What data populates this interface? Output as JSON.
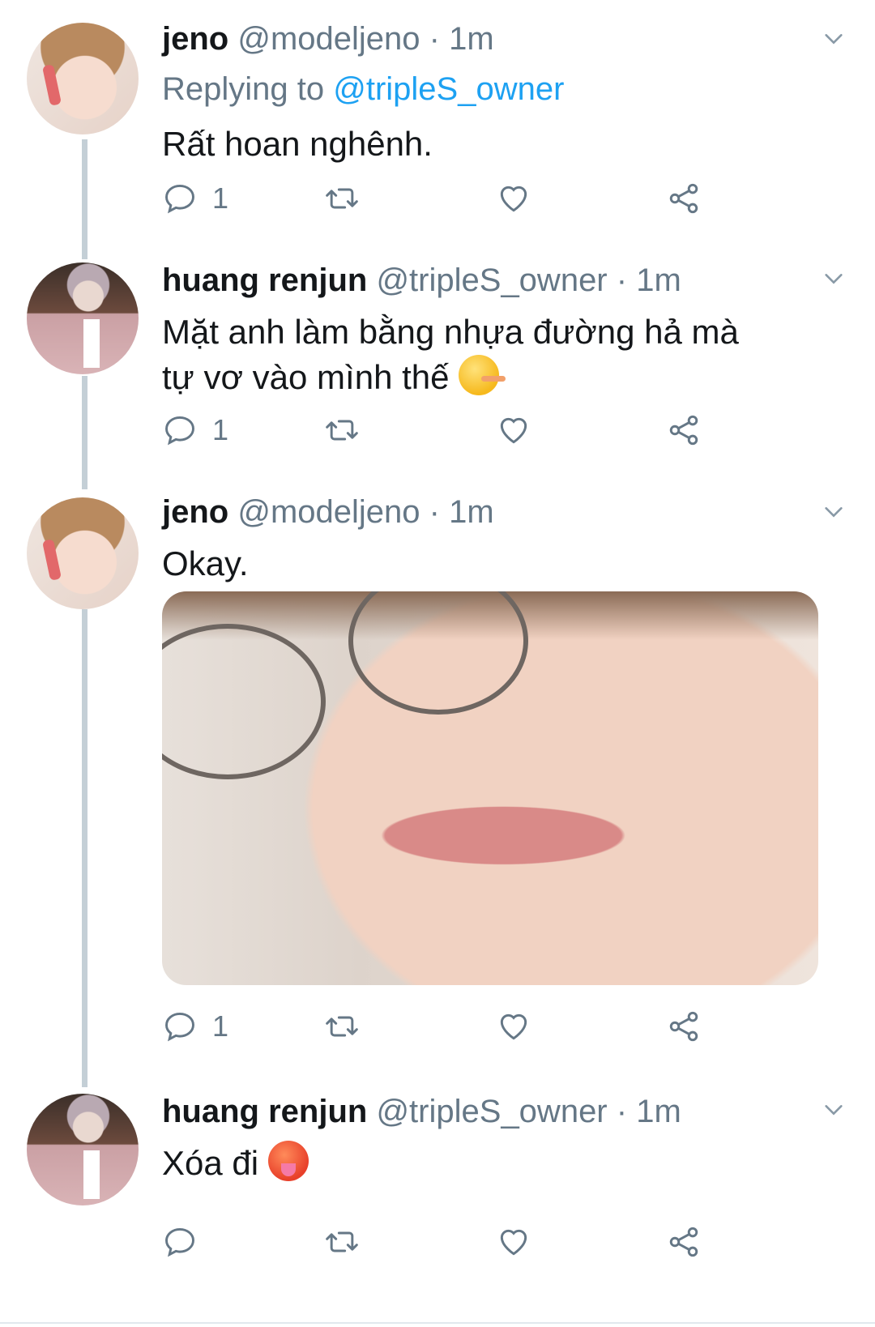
{
  "tweets": [
    {
      "name": "jeno",
      "handle": "@modeljeno",
      "dot": "·",
      "time": "1m",
      "replying_to_prefix": "Replying to",
      "replying_to_handle": "@tripleS_owner",
      "text": "Rất hoan nghênh.",
      "reply_count": "1"
    },
    {
      "name": "huang renjun",
      "handle": "@tripleS_owner",
      "dot": "·",
      "time": "1m",
      "text_line1": "Mặt anh làm bằng nhựa đường hả mà",
      "text_line2": "tự vơ vào mình thế",
      "emoji": "lying-face",
      "reply_count": "1"
    },
    {
      "name": "jeno",
      "handle": "@modeljeno",
      "dot": "·",
      "time": "1m",
      "text": "Okay.",
      "reply_count": "1"
    },
    {
      "name": "huang renjun",
      "handle": "@tripleS_owner",
      "dot": "·",
      "time": "1m",
      "text": "Xóa đi",
      "emoji": "hot-face",
      "reply_count": ""
    }
  ],
  "icons": {
    "reply": "reply-icon",
    "retweet": "retweet-icon",
    "like": "heart-icon",
    "share": "share-icon",
    "more": "chevron-down-icon"
  },
  "colors": {
    "text": "#14171a",
    "secondary": "#657786",
    "link": "#1da1f2",
    "thread_line": "#c4cfd6",
    "icon": "#657786"
  }
}
